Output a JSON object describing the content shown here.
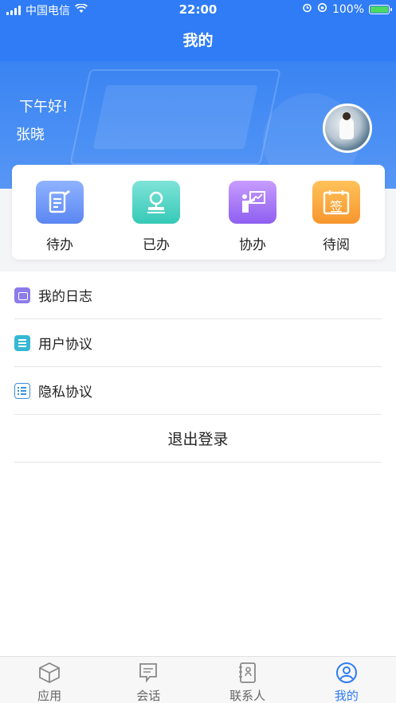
{
  "status": {
    "carrier": "中国电信",
    "time": "22:00",
    "battery": "100%"
  },
  "header": {
    "title": "我的"
  },
  "profile": {
    "greeting": "下午好!",
    "name": "张晓"
  },
  "quick_actions": [
    {
      "label": "待办",
      "icon": "edit-icon"
    },
    {
      "label": "已办",
      "icon": "stamp-icon"
    },
    {
      "label": "协办",
      "icon": "presentation-icon"
    },
    {
      "label": "待阅",
      "icon": "sign-icon",
      "icon_text": "签"
    }
  ],
  "menu": {
    "items": [
      {
        "label": "我的日志",
        "icon": "briefcase-icon"
      },
      {
        "label": "用户协议",
        "icon": "document-icon"
      },
      {
        "label": "隐私协议",
        "icon": "list-icon"
      }
    ],
    "logout_label": "退出登录"
  },
  "tabbar": {
    "tabs": [
      {
        "label": "应用",
        "icon": "cube-icon",
        "active": false
      },
      {
        "label": "会话",
        "icon": "chat-icon",
        "active": false
      },
      {
        "label": "联系人",
        "icon": "contacts-icon",
        "active": false
      },
      {
        "label": "我的",
        "icon": "user-icon",
        "active": true
      }
    ]
  },
  "colors": {
    "primary": "#2f7cf6",
    "background": "#ffffff",
    "divider": "#e5e5e5"
  }
}
